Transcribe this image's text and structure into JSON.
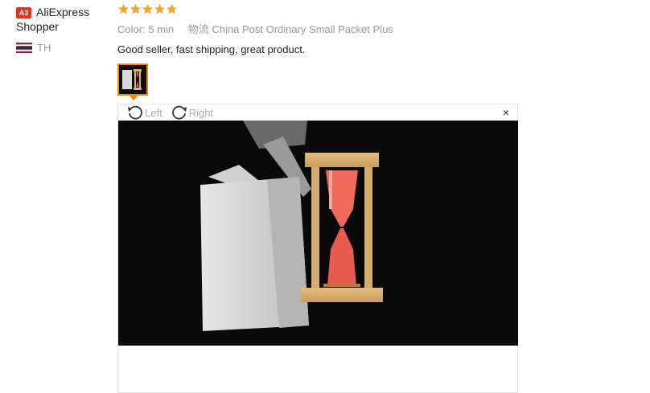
{
  "reviewer": {
    "badge": "A3",
    "name": "AliExpress Shopper",
    "country_code": "TH"
  },
  "review": {
    "rating": 5,
    "color_label": "Color:",
    "color_value": "5 min",
    "shipping_label": "物流",
    "shipping_value": "China Post Ordinary Small Packet Plus",
    "text": "Good seller, fast shipping, great product."
  },
  "viewer": {
    "rotate_left": "Left",
    "rotate_right": "Right",
    "close": "×"
  },
  "colors": {
    "star": "#f5a623",
    "badge": "#e0321c",
    "thumb_border": "#f08a00"
  }
}
